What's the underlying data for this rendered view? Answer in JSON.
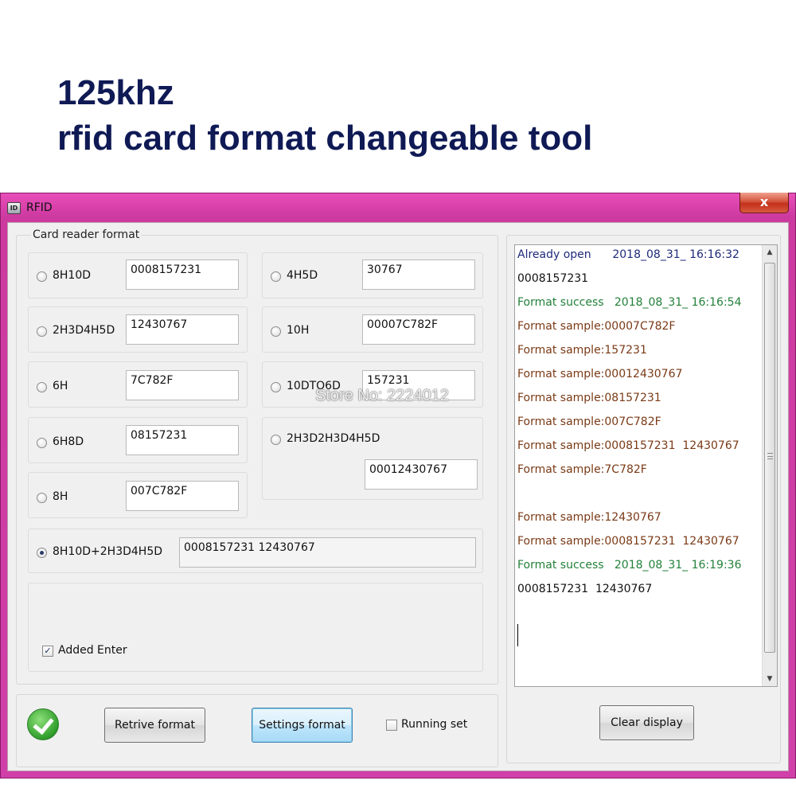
{
  "headline": {
    "line1": "125khz",
    "line2": "rfid card format changeable tool"
  },
  "window": {
    "title": "RFID",
    "icon_text": "ID",
    "close_glyph": "x"
  },
  "format_group": {
    "title": "Card reader format",
    "options": [
      {
        "label": "8H10D",
        "value": "0008157231",
        "selected": false
      },
      {
        "label": "4H5D",
        "value": "30767",
        "selected": false
      },
      {
        "label": "2H3D4H5D",
        "value": "12430767",
        "selected": false
      },
      {
        "label": "10H",
        "value": "00007C782F",
        "selected": false
      },
      {
        "label": "6H",
        "value": "7C782F",
        "selected": false
      },
      {
        "label": "10DTO6D",
        "value": "157231",
        "selected": false
      },
      {
        "label": "6H8D",
        "value": "08157231",
        "selected": false
      },
      {
        "label": "2H3D2H3D4H5D",
        "value": "00012430767",
        "selected": false
      },
      {
        "label": "8H",
        "value": "007C782F",
        "selected": false
      },
      {
        "label": "8H10D+2H3D4H5D",
        "value": "0008157231  12430767",
        "selected": true
      }
    ],
    "added_enter": {
      "label": "Added Enter",
      "checked": true
    }
  },
  "bottom_bar": {
    "retrive_label": "Retrive format",
    "settings_label": "Settings format",
    "running_set": {
      "label": "Running set",
      "checked": false
    }
  },
  "log": {
    "lines": [
      {
        "text": "Already open      2018_08_31_ 16:16:32",
        "color": "#1f2a7a"
      },
      {
        "text": "0008157231",
        "color": "#111111"
      },
      {
        "text": "Format success   2018_08_31_ 16:16:54",
        "color": "#23803a"
      },
      {
        "text": "Format sample:00007C782F",
        "color": "#7a3a16"
      },
      {
        "text": "Format sample:157231",
        "color": "#7a3a16"
      },
      {
        "text": "Format sample:00012430767",
        "color": "#7a3a16"
      },
      {
        "text": "Format sample:08157231",
        "color": "#7a3a16"
      },
      {
        "text": "Format sample:007C782F",
        "color": "#7a3a16"
      },
      {
        "text": "Format sample:0008157231  12430767",
        "color": "#7a3a16"
      },
      {
        "text": "Format sample:7C782F",
        "color": "#7a3a16"
      },
      {
        "text": "Format sample:12430767",
        "color": "#7a3a16"
      },
      {
        "text": "Format sample:0008157231  12430767",
        "color": "#7a3a16"
      },
      {
        "text": "Format success   2018_08_31_ 16:19:36",
        "color": "#23803a"
      },
      {
        "text": "0008157231  12430767",
        "color": "#111111"
      }
    ],
    "clear_label": "Clear display"
  },
  "watermark": "Store No: 2224012"
}
